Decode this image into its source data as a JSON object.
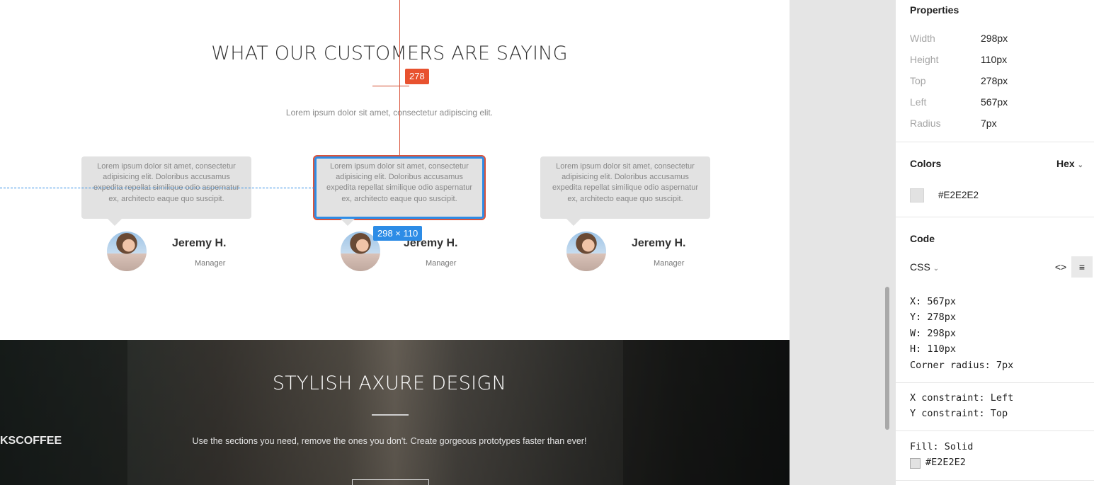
{
  "canvas": {
    "section_title": "WHAT OUR CUSTOMERS ARE SAYING",
    "section_subtitle": "Lorem ipsum dolor sit amet, consectetur adipiscing elit.",
    "testimonials": [
      {
        "quote": "Lorem ipsum dolor sit amet, consectetur adipisicing elit. Doloribus accusamus expedita repellat similique odio aspernatur ex, architecto eaque quo suscipit.",
        "name": "Jeremy H.",
        "role": "Manager"
      },
      {
        "quote": "Lorem ipsum dolor sit amet, consectetur adipisicing elit. Doloribus accusamus expedita repellat similique odio aspernatur ex, architecto eaque quo suscipit.",
        "name": "Jeremy H.",
        "role": "Manager"
      },
      {
        "quote": "Lorem ipsum dolor sit amet, consectetur adipisicing elit. Doloribus accusamus expedita repellat similique odio aspernatur ex, architecto eaque quo suscipit.",
        "name": "Jeremy H.",
        "role": "Manager"
      }
    ],
    "measure_badge": "278",
    "size_badge": "298 × 110",
    "hero": {
      "title": "STYLISH AXURE DESIGN",
      "text": "Use the sections you need, remove the ones you don't.  Create gorgeous prototypes faster than ever!",
      "sign": "KSCOFFEE"
    }
  },
  "panel": {
    "properties": {
      "heading": "Properties",
      "rows": [
        {
          "label": "Width",
          "value": "298px"
        },
        {
          "label": "Height",
          "value": "110px"
        },
        {
          "label": "Top",
          "value": "278px"
        },
        {
          "label": "Left",
          "value": "567px"
        },
        {
          "label": "Radius",
          "value": "7px"
        }
      ]
    },
    "colors": {
      "heading": "Colors",
      "format": "Hex",
      "swatch_value": "#E2E2E2",
      "swatch_color": "#e2e2e2"
    },
    "code": {
      "heading": "Code",
      "language": "CSS",
      "lines1": [
        "X: 567px",
        "Y: 278px",
        "W: 298px",
        "H: 110px",
        "Corner radius: 7px"
      ],
      "lines2": [
        "X constraint: Left",
        "Y constraint: Top"
      ],
      "fill_label": "Fill: Solid",
      "fill_value": "#E2E2E2"
    }
  },
  "icons": {
    "code_toggle": "code-brackets-icon",
    "text_align": "align-left-icon",
    "chevron": "chevron-down-icon"
  },
  "accent_colors": {
    "guide_red": "#d9533b",
    "guide_blue": "#2d8ce6"
  }
}
